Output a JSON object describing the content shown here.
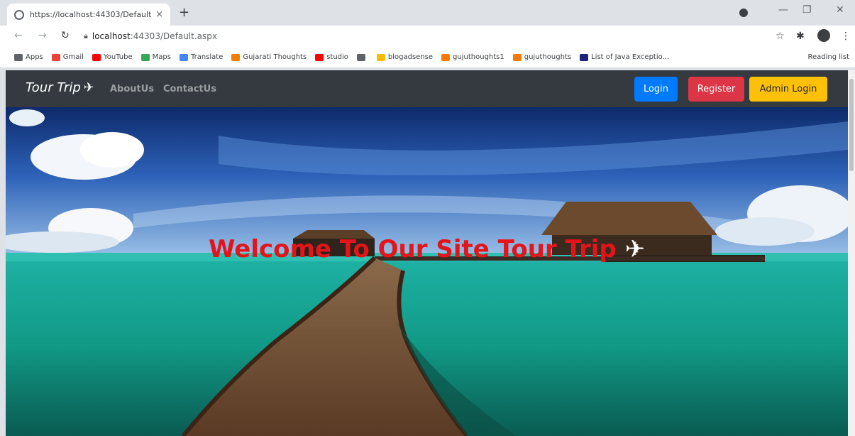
{
  "browser": {
    "tab_title": "https://localhost:44303/Default.",
    "tab_close": "×",
    "new_tab": "+",
    "window_controls": [
      "—",
      "❐",
      "✕"
    ],
    "url_host": "localhost",
    "url_path": ":44303/Default.aspx",
    "bookmarks": [
      {
        "label": "Apps",
        "color": "#5f6368"
      },
      {
        "label": "Gmail",
        "color": "#ea4335"
      },
      {
        "label": "YouTube",
        "color": "#ff0000"
      },
      {
        "label": "Maps",
        "color": "#34a853"
      },
      {
        "label": "Translate",
        "color": "#4285f4"
      },
      {
        "label": "Gujarati Thoughts",
        "color": "#f57c00"
      },
      {
        "label": "studio",
        "color": "#ff0000"
      },
      {
        "label": "",
        "color": "#5f6368"
      },
      {
        "label": "blogadsense",
        "color": "#fbbc04"
      },
      {
        "label": "gujuthoughts1",
        "color": "#f57c00"
      },
      {
        "label": "gujuthoughts",
        "color": "#f57c00"
      },
      {
        "label": "List of Java Exceptio...",
        "color": "#1a237e"
      }
    ],
    "reading_list": "Reading list"
  },
  "site": {
    "brand": "Tour Trip",
    "brand_icon": "✈",
    "nav_links": [
      "AboutUs",
      "ContactUs"
    ],
    "buttons": {
      "login": "Login",
      "register": "Register",
      "admin_login": "Admin Login"
    },
    "hero_title": "Welcome To Our Site Tour Trip",
    "hero_icon": "✈"
  },
  "colors": {
    "navbar": "#343a40",
    "login": "#007bff",
    "register": "#dc3545",
    "admin_login": "#ffc107",
    "hero_title": "#e4141b"
  }
}
